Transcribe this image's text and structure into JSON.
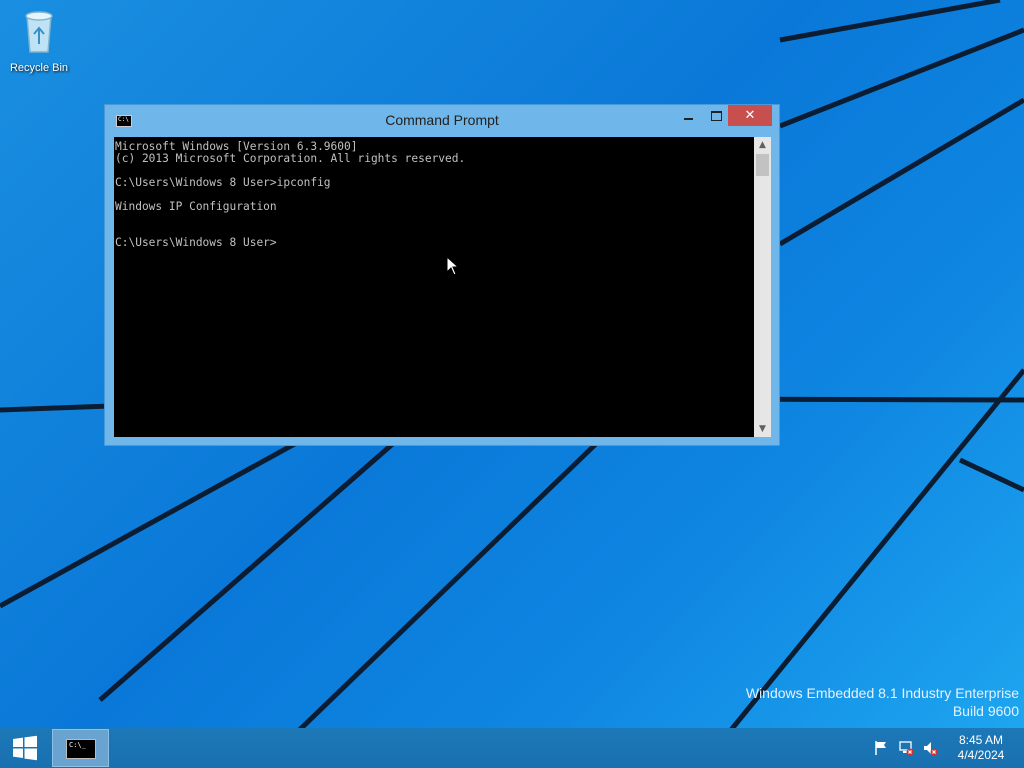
{
  "desktop": {
    "icons": [
      {
        "label": "Recycle Bin",
        "icon": "recycle-bin-icon"
      }
    ],
    "watermark": {
      "line1": "Windows Embedded 8.1 Industry Enterprise",
      "line2": "Build 9600"
    }
  },
  "window": {
    "title": "Command Prompt",
    "icon": "cmd-icon",
    "console_lines": [
      "Microsoft Windows [Version 6.3.9600]",
      "(c) 2013 Microsoft Corporation. All rights reserved.",
      "",
      "C:\\Users\\Windows 8 User>ipconfig",
      "",
      "Windows IP Configuration",
      "",
      "",
      "C:\\Users\\Windows 8 User>"
    ]
  },
  "taskbar": {
    "start_icon": "windows-logo-icon",
    "items": [
      {
        "name": "Command Prompt",
        "icon": "cmd-icon"
      }
    ],
    "tray": {
      "icons": [
        "action-center-flag-icon",
        "network-error-icon",
        "volume-muted-icon"
      ],
      "time": "8:45 AM",
      "date": "4/4/2024"
    }
  },
  "colors": {
    "desktop_blue": "#0a78d8",
    "window_frame": "#6fb6ea",
    "close_button": "#c7504e",
    "taskbar": "#1d78b8"
  }
}
